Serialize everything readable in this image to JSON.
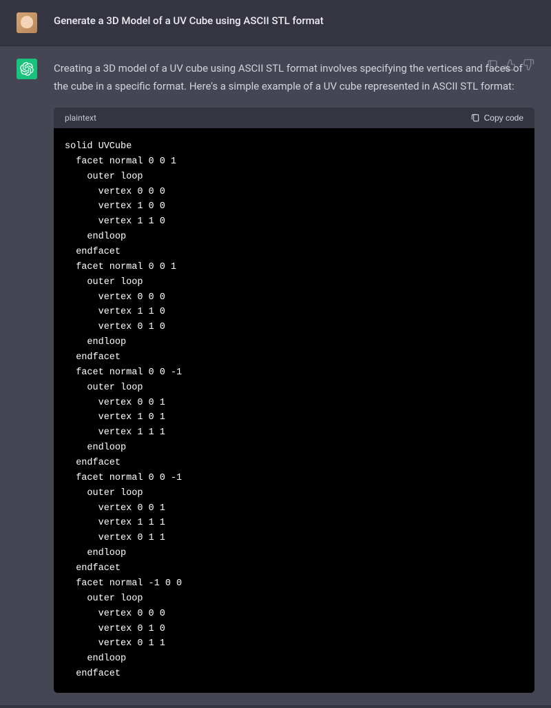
{
  "user_message": {
    "text": "Generate a 3D Model of a UV Cube using ASCII STL format"
  },
  "assistant_message": {
    "intro_text": "Creating a 3D model of a UV cube using ASCII STL format involves specifying the vertices and faces of the cube in a specific format. Here's a simple example of a UV cube represented in ASCII STL format:"
  },
  "code_block": {
    "language": "plaintext",
    "copy_label": "Copy code",
    "content": "solid UVCube\n  facet normal 0 0 1\n    outer loop\n      vertex 0 0 0\n      vertex 1 0 0\n      vertex 1 1 0\n    endloop\n  endfacet\n  facet normal 0 0 1\n    outer loop\n      vertex 0 0 0\n      vertex 1 1 0\n      vertex 0 1 0\n    endloop\n  endfacet\n  facet normal 0 0 -1\n    outer loop\n      vertex 0 0 1\n      vertex 1 0 1\n      vertex 1 1 1\n    endloop\n  endfacet\n  facet normal 0 0 -1\n    outer loop\n      vertex 0 0 1\n      vertex 1 1 1\n      vertex 0 1 1\n    endloop\n  endfacet\n  facet normal -1 0 0\n    outer loop\n      vertex 0 0 0\n      vertex 0 1 0\n      vertex 0 1 1\n    endloop\n  endfacet"
  },
  "actions": {
    "copy": "copy",
    "thumbs_up": "thumbs-up",
    "thumbs_down": "thumbs-down"
  }
}
